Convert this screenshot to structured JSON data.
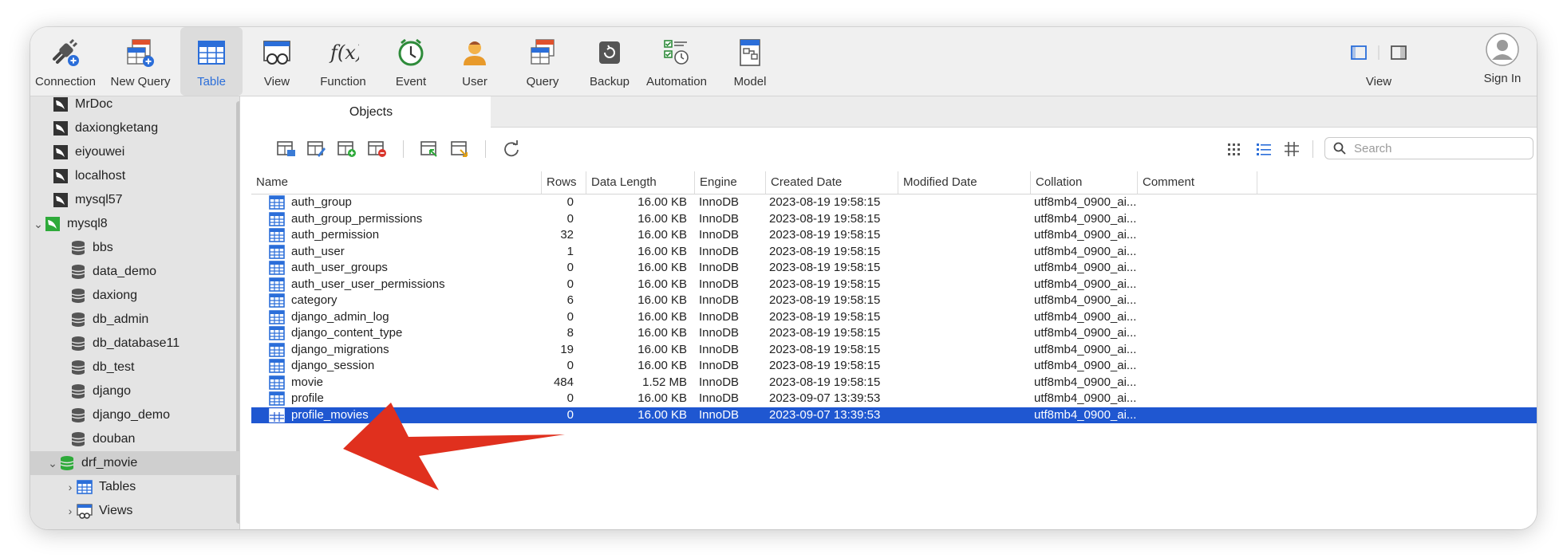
{
  "toolbar": {
    "items": [
      {
        "label": "Connection",
        "icon": "connection-icon"
      },
      {
        "label": "New Query",
        "icon": "new-query-icon"
      },
      {
        "label": "Table",
        "icon": "table-icon",
        "active": true
      },
      {
        "label": "View",
        "icon": "view-icon"
      },
      {
        "label": "Function",
        "icon": "function-icon"
      },
      {
        "label": "Event",
        "icon": "event-clock-icon"
      },
      {
        "label": "User",
        "icon": "user-icon"
      },
      {
        "label": "Query",
        "icon": "query-icon"
      },
      {
        "label": "Backup",
        "icon": "backup-icon"
      },
      {
        "label": "Automation",
        "icon": "automation-icon"
      },
      {
        "label": "Model",
        "icon": "model-icon"
      }
    ],
    "right": {
      "view_label": "View",
      "sign_in_label": "Sign In"
    },
    "accent": "#2b6ed9"
  },
  "sidebar": {
    "items": [
      {
        "label": "MrDoc",
        "type": "connection"
      },
      {
        "label": "daxiongketang",
        "type": "connection"
      },
      {
        "label": "eiyouwei",
        "type": "connection"
      },
      {
        "label": "localhost",
        "type": "connection"
      },
      {
        "label": "mysql57",
        "type": "connection"
      },
      {
        "label": "mysql8",
        "type": "connection-active",
        "expanded": true
      },
      {
        "label": "bbs",
        "type": "database"
      },
      {
        "label": "data_demo",
        "type": "database"
      },
      {
        "label": "daxiong",
        "type": "database"
      },
      {
        "label": "db_admin",
        "type": "database"
      },
      {
        "label": "db_database11",
        "type": "database"
      },
      {
        "label": "db_test",
        "type": "database"
      },
      {
        "label": "django",
        "type": "database"
      },
      {
        "label": "django_demo",
        "type": "database"
      },
      {
        "label": "douban",
        "type": "database"
      },
      {
        "label": "drf_movie",
        "type": "database-open",
        "expanded": true
      },
      {
        "label": "Tables",
        "type": "tables-group"
      },
      {
        "label": "Views",
        "type": "views-group"
      }
    ]
  },
  "tabs": [
    {
      "label": "Objects"
    }
  ],
  "search": {
    "placeholder": "Search"
  },
  "table": {
    "columns": [
      "Name",
      "Rows",
      "Data Length",
      "Engine",
      "Created Date",
      "Modified Date",
      "Collation",
      "Comment"
    ],
    "rows": [
      {
        "name": "auth_group",
        "rows": "0",
        "data_length": "16.00 KB",
        "engine": "InnoDB",
        "created": "2023-08-19 19:58:15",
        "modified": "",
        "collation": "utf8mb4_0900_ai...",
        "comment": ""
      },
      {
        "name": "auth_group_permissions",
        "rows": "0",
        "data_length": "16.00 KB",
        "engine": "InnoDB",
        "created": "2023-08-19 19:58:15",
        "modified": "",
        "collation": "utf8mb4_0900_ai...",
        "comment": ""
      },
      {
        "name": "auth_permission",
        "rows": "32",
        "data_length": "16.00 KB",
        "engine": "InnoDB",
        "created": "2023-08-19 19:58:15",
        "modified": "",
        "collation": "utf8mb4_0900_ai...",
        "comment": ""
      },
      {
        "name": "auth_user",
        "rows": "1",
        "data_length": "16.00 KB",
        "engine": "InnoDB",
        "created": "2023-08-19 19:58:15",
        "modified": "",
        "collation": "utf8mb4_0900_ai...",
        "comment": ""
      },
      {
        "name": "auth_user_groups",
        "rows": "0",
        "data_length": "16.00 KB",
        "engine": "InnoDB",
        "created": "2023-08-19 19:58:15",
        "modified": "",
        "collation": "utf8mb4_0900_ai...",
        "comment": ""
      },
      {
        "name": "auth_user_user_permissions",
        "rows": "0",
        "data_length": "16.00 KB",
        "engine": "InnoDB",
        "created": "2023-08-19 19:58:15",
        "modified": "",
        "collation": "utf8mb4_0900_ai...",
        "comment": ""
      },
      {
        "name": "category",
        "rows": "6",
        "data_length": "16.00 KB",
        "engine": "InnoDB",
        "created": "2023-08-19 19:58:15",
        "modified": "",
        "collation": "utf8mb4_0900_ai...",
        "comment": ""
      },
      {
        "name": "django_admin_log",
        "rows": "0",
        "data_length": "16.00 KB",
        "engine": "InnoDB",
        "created": "2023-08-19 19:58:15",
        "modified": "",
        "collation": "utf8mb4_0900_ai...",
        "comment": ""
      },
      {
        "name": "django_content_type",
        "rows": "8",
        "data_length": "16.00 KB",
        "engine": "InnoDB",
        "created": "2023-08-19 19:58:15",
        "modified": "",
        "collation": "utf8mb4_0900_ai...",
        "comment": ""
      },
      {
        "name": "django_migrations",
        "rows": "19",
        "data_length": "16.00 KB",
        "engine": "InnoDB",
        "created": "2023-08-19 19:58:15",
        "modified": "",
        "collation": "utf8mb4_0900_ai...",
        "comment": ""
      },
      {
        "name": "django_session",
        "rows": "0",
        "data_length": "16.00 KB",
        "engine": "InnoDB",
        "created": "2023-08-19 19:58:15",
        "modified": "",
        "collation": "utf8mb4_0900_ai...",
        "comment": ""
      },
      {
        "name": "movie",
        "rows": "484",
        "data_length": "1.52 MB",
        "engine": "InnoDB",
        "created": "2023-08-19 19:58:15",
        "modified": "",
        "collation": "utf8mb4_0900_ai...",
        "comment": ""
      },
      {
        "name": "profile",
        "rows": "0",
        "data_length": "16.00 KB",
        "engine": "InnoDB",
        "created": "2023-09-07 13:39:53",
        "modified": "",
        "collation": "utf8mb4_0900_ai...",
        "comment": ""
      },
      {
        "name": "profile_movies",
        "rows": "0",
        "data_length": "16.00 KB",
        "engine": "InnoDB",
        "created": "2023-09-07 13:39:53",
        "modified": "",
        "collation": "utf8mb4_0900_ai...",
        "comment": "",
        "selected": true
      }
    ]
  },
  "colors": {
    "selection": "#1f57d1",
    "annotation_arrow": "#e0301e"
  }
}
